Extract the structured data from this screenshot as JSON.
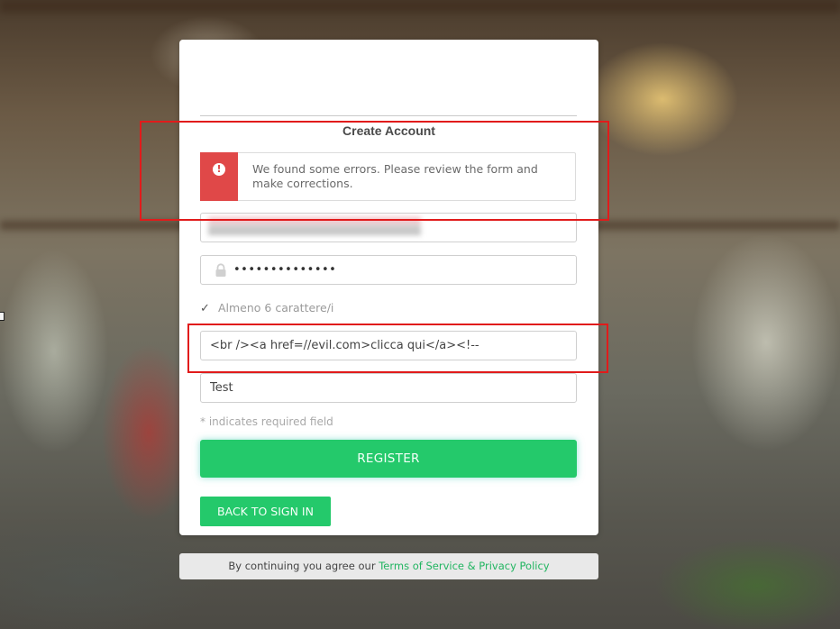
{
  "form": {
    "title": "Create Account",
    "error_message": "We found some errors. Please review the form and make corrections.",
    "error_icon_glyph": "!",
    "password_value": "••••••••••••••",
    "password_hint": "Almeno 6 carattere/i",
    "hint_check_glyph": "✓",
    "field3_value": "<br /><a href=//evil.com>clicca qui</a><!--",
    "field4_value": "Test",
    "required_note": "* indicates required field",
    "register_label": "REGISTER",
    "back_label": "BACK TO SIGN IN"
  },
  "footer": {
    "prefix": "By continuing you agree our ",
    "link_text": "Terms of Service & Privacy Policy"
  },
  "colors": {
    "accent_green": "#24c96b",
    "error_red": "#e04848",
    "highlight_red": "#e11b1b"
  },
  "icons": {
    "error": "exclamation-circle-icon",
    "lock": "lock-icon",
    "check": "checkmark-icon"
  }
}
